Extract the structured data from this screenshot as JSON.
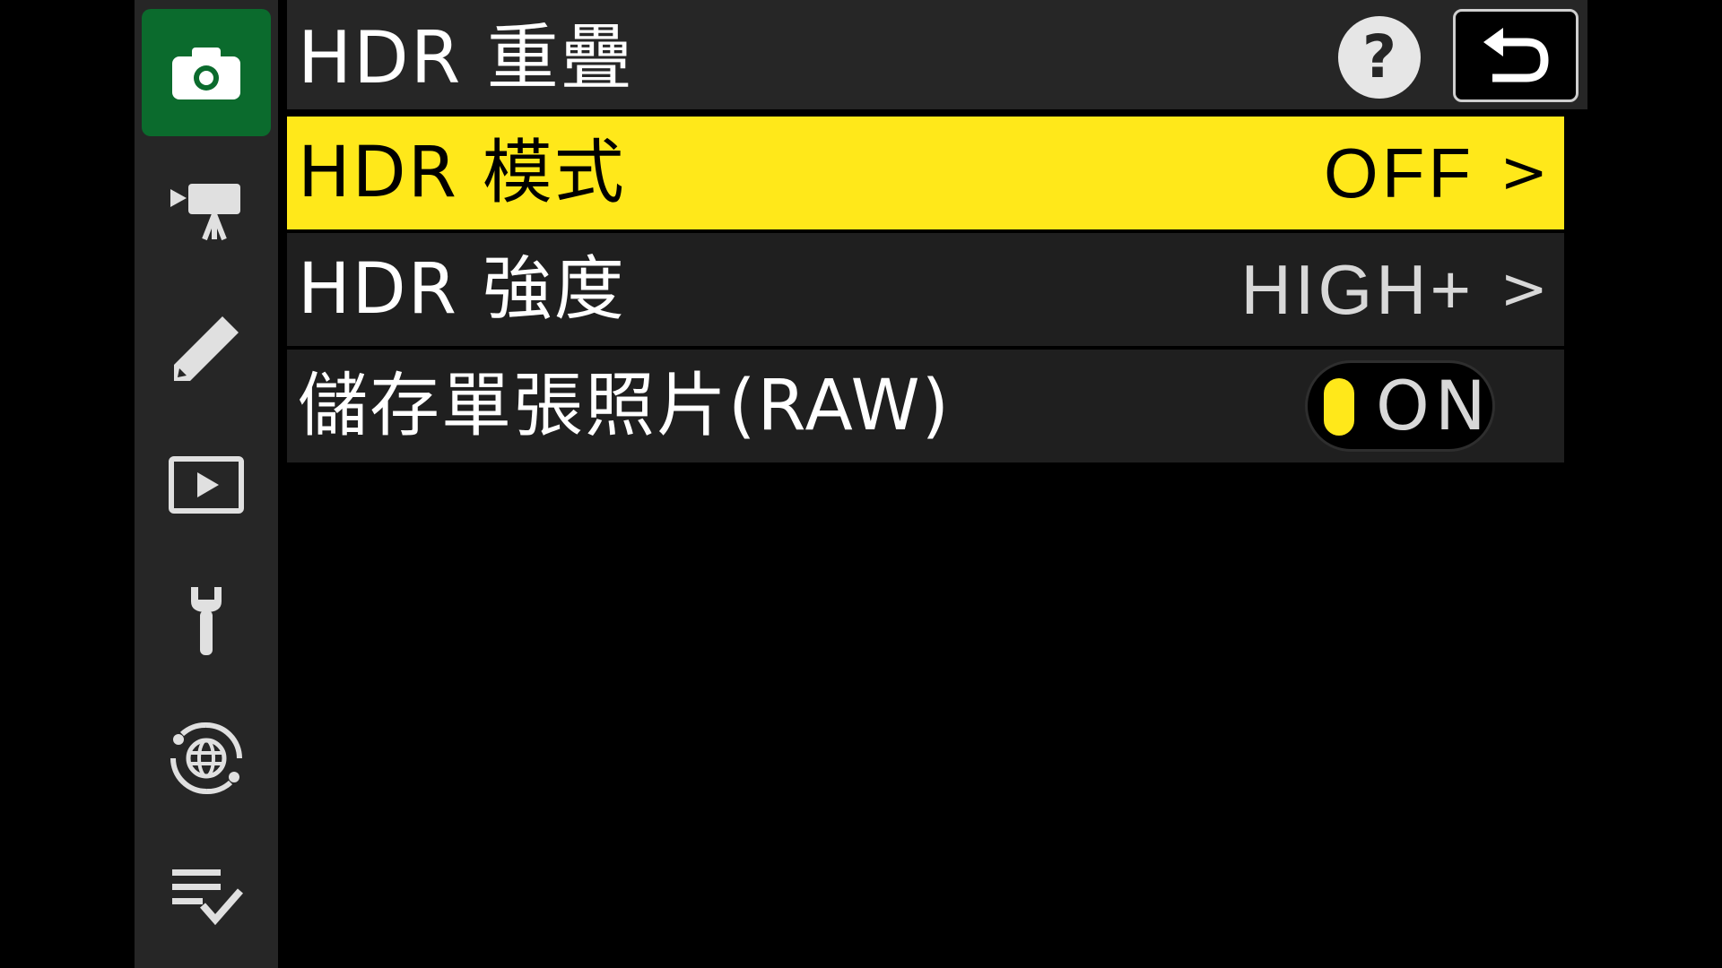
{
  "header": {
    "title": "HDR 重疊",
    "help_label": "?"
  },
  "sidebar": {
    "items": [
      {
        "icon": "camera-icon",
        "active": true
      },
      {
        "icon": "movie-camera-icon",
        "active": false
      },
      {
        "icon": "pencil-icon",
        "active": false
      },
      {
        "icon": "playback-icon",
        "active": false
      },
      {
        "icon": "wrench-icon",
        "active": false
      },
      {
        "icon": "network-globe-icon",
        "active": false
      },
      {
        "icon": "my-menu-checklist-icon",
        "active": false
      }
    ]
  },
  "menu": {
    "rows": [
      {
        "label": "HDR 模式",
        "value": "OFF",
        "selected": true
      },
      {
        "label": "HDR 強度",
        "value": "HIGH+",
        "selected": false
      },
      {
        "label": "儲存單張照片(RAW)",
        "toggle": "ON",
        "selected": false
      }
    ]
  },
  "colors": {
    "accent": "#ffe81a",
    "active_tab": "#0b6b2d",
    "panel": "#262626"
  }
}
